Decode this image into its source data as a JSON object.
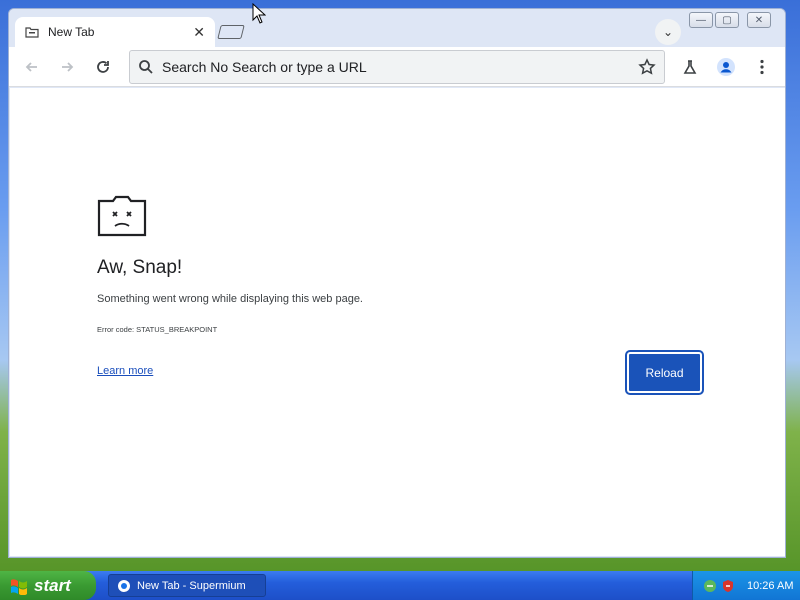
{
  "browser": {
    "tab": {
      "title": "New Tab",
      "close_glyph": "✕"
    },
    "tab_search_glyph": "⌄",
    "window_controls": {
      "minimize": "—",
      "maximize": "▢",
      "close": "✕"
    },
    "omnibox": {
      "text": "Search No Search or type a URL"
    },
    "icons": [
      "back-arrow-icon",
      "forward-arrow-icon",
      "reload-icon",
      "search-icon",
      "star-icon",
      "labs-flask-icon",
      "profile-icon",
      "menu-dots-icon"
    ]
  },
  "error_page": {
    "heading": "Aw, Snap!",
    "description": "Something went wrong while displaying this web page.",
    "error_code": "Error code: STATUS_BREAKPOINT",
    "learn_more": "Learn more",
    "reload_label": "Reload"
  },
  "taskbar": {
    "start_label": "start",
    "task_label": "New Tab - Supermium",
    "clock": "10:26 AM"
  },
  "colors": {
    "accent": "#1a53b9",
    "link": "#1a4ebc",
    "taskbar": "#245edb",
    "start": "#3a9a32"
  }
}
